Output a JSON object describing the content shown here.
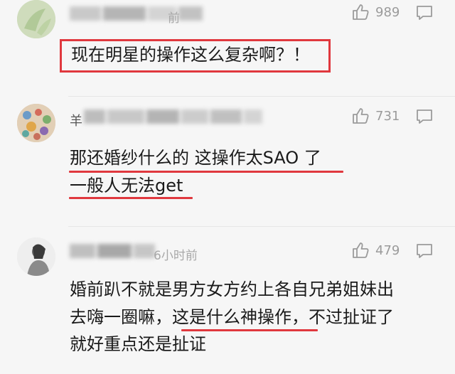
{
  "comments": [
    {
      "time_suffix": "前",
      "likes": "989",
      "lines": [
        "现在明星的操作这么复杂啊？！"
      ],
      "avatar_color": "#c9d9b4"
    },
    {
      "name_glyph": "羊",
      "likes": "731",
      "lines": [
        "那还婚纱什么的 这操作太SAO 了",
        "一般人无法get"
      ],
      "avatar_color": "#d8c2a8"
    },
    {
      "time_suffix": "6小时前",
      "likes": "479",
      "lines": [
        "婚前趴不就是男方女方约上各自兄弟姐妹出",
        "去嗨一圈嘛，这是什么神操作，不过扯证了",
        "就好重点还是扯证"
      ],
      "avatar_color": "#e4e4e4"
    }
  ],
  "colors": {
    "highlight": "#e0383e",
    "background": "#f6f6f6",
    "meta_text": "#9b9b9b"
  }
}
